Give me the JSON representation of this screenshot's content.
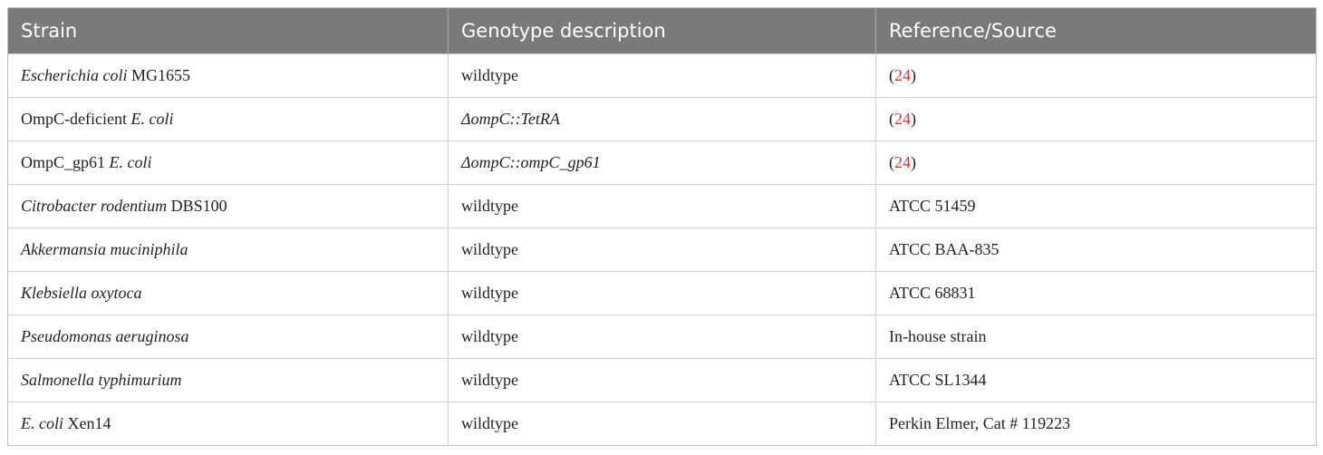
{
  "table": {
    "headers": [
      "Strain",
      "Genotype description",
      "Reference/Source"
    ],
    "rows": [
      {
        "strain_italic": "Escherichia coli",
        "strain_plain": " MG1655",
        "strain_plain_first": "",
        "genotype": "wildtype",
        "genotype_italic": false,
        "ref_open": "(",
        "ref_link": "24",
        "ref_close": ")",
        "source": ""
      },
      {
        "strain_plain_first": "OmpC-deficient ",
        "strain_italic": "E. coli",
        "strain_plain": "",
        "genotype": "ΔompC::TetRA",
        "genotype_italic": true,
        "ref_open": "(",
        "ref_link": "24",
        "ref_close": ")",
        "source": ""
      },
      {
        "strain_plain_first": "OmpC_gp61 ",
        "strain_italic": "E. coli",
        "strain_plain": "",
        "genotype": "ΔompC::ompC_gp61",
        "genotype_italic": true,
        "ref_open": "(",
        "ref_link": "24",
        "ref_close": ")",
        "source": ""
      },
      {
        "strain_plain_first": "",
        "strain_italic": "Citrobacter rodentium",
        "strain_plain": " DBS100",
        "genotype": "wildtype",
        "genotype_italic": false,
        "ref_open": "",
        "ref_link": "",
        "ref_close": "",
        "source": "ATCC 51459"
      },
      {
        "strain_plain_first": "",
        "strain_italic": "Akkermansia muciniphila",
        "strain_plain": "",
        "genotype": "wildtype",
        "genotype_italic": false,
        "ref_open": "",
        "ref_link": "",
        "ref_close": "",
        "source": "ATCC BAA-835"
      },
      {
        "strain_plain_first": "",
        "strain_italic": "Klebsiella oxytoca",
        "strain_plain": "",
        "genotype": "wildtype",
        "genotype_italic": false,
        "ref_open": "",
        "ref_link": "",
        "ref_close": "",
        "source": "ATCC 68831"
      },
      {
        "strain_plain_first": "",
        "strain_italic": "Pseudomonas aeruginosa",
        "strain_plain": "",
        "genotype": "wildtype",
        "genotype_italic": false,
        "ref_open": "",
        "ref_link": "",
        "ref_close": "",
        "source": "In-house strain"
      },
      {
        "strain_plain_first": "",
        "strain_italic": "Salmonella typhimurium",
        "strain_plain": "",
        "genotype": "wildtype",
        "genotype_italic": false,
        "ref_open": "",
        "ref_link": "",
        "ref_close": "",
        "source": "ATCC SL1344"
      },
      {
        "strain_plain_first": "",
        "strain_italic": "E. coli",
        "strain_plain": " Xen14",
        "genotype": "wildtype",
        "genotype_italic": false,
        "ref_open": "",
        "ref_link": "",
        "ref_close": "",
        "source": "Perkin Elmer, Cat # 119223"
      }
    ]
  },
  "colors": {
    "header_bg": "#7a7a7a",
    "header_text": "#ffffff",
    "link": "#d6322e",
    "border": "#cfcfcf"
  }
}
